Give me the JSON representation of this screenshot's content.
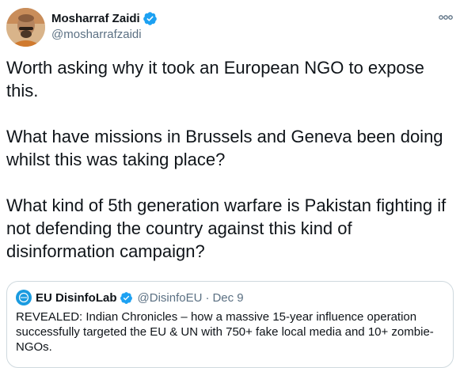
{
  "author": {
    "display_name": "Mosharraf Zaidi",
    "handle": "@mosharrafzaidi",
    "verified": true
  },
  "tweet": {
    "paragraphs": [
      "Worth asking why it took an European NGO to expose this.",
      "What have missions in Brussels and Geneva been doing whilst this was taking place?",
      "What kind of 5th generation warfare is Pakistan fighting if not defending the country against this kind of disinformation campaign?"
    ]
  },
  "quoted_tweet": {
    "display_name": "EU DisinfoLab",
    "handle": "@DisinfoEU",
    "separator": "·",
    "date": "Dec 9",
    "verified": true,
    "text": "REVEALED: Indian Chronicles – how a massive 15-year influence operation successfully targeted the EU & UN with 750+ fake local media and 10+ zombie-NGOs."
  },
  "icons": {
    "verified": "verified-badge-icon",
    "more": "more-options-icon"
  },
  "colors": {
    "accent": "#1da1f2",
    "text_primary": "#0f1419",
    "text_secondary": "#5b7083",
    "border": "#cfd9de"
  }
}
